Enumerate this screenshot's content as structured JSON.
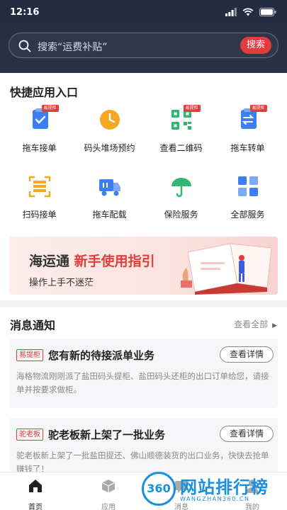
{
  "status_bar": {
    "time": "12:16"
  },
  "search": {
    "placeholder": "搜索“运费补贴”",
    "button": "搜索"
  },
  "quick_apps": {
    "title": "快捷应用入口",
    "items": [
      {
        "label": "拖车接单",
        "badge": "易提柜",
        "icon": "document-check-icon"
      },
      {
        "label": "码头堆场预约",
        "badge": "",
        "icon": "clock-icon"
      },
      {
        "label": "查看二维码",
        "badge": "易提柜",
        "icon": "qr-code-icon"
      },
      {
        "label": "拖车转单",
        "badge": "易提柜",
        "icon": "transfer-document-icon"
      },
      {
        "label": "扫码接单",
        "badge": "",
        "icon": "scan-icon"
      },
      {
        "label": "拖车配载",
        "badge": "",
        "icon": "truck-icon"
      },
      {
        "label": "保险服务",
        "badge": "",
        "icon": "umbrella-icon"
      },
      {
        "label": "全部服务",
        "badge": "",
        "icon": "grid-icon"
      }
    ]
  },
  "banner": {
    "brand": "海运通",
    "highlight": "新手使用指引",
    "subtitle": "操作上手不迷茫"
  },
  "messages": {
    "title": "消息通知",
    "view_all": "查看全部",
    "items": [
      {
        "tag": "易提柜",
        "title": "您有新的待接派单业务",
        "action": "查看详情",
        "body": "海格物流刚刚派了盐田码头提柜、盐田码头还柜的出口订单给您，请接单并按要求做柜。"
      },
      {
        "tag": "驼老板",
        "title": "驼老板新上架了一批业务",
        "action": "查看详情",
        "body": "驼老板新上架了一批盐田提还、佛山顺德装货的出口业务，快快去抢单赚钱了！"
      }
    ]
  },
  "tab_bar": {
    "items": [
      {
        "label": "首页"
      },
      {
        "label": "应用"
      },
      {
        "label": "消息"
      },
      {
        "label": "我的"
      }
    ]
  },
  "watermark": {
    "logo": "360",
    "title": "网站排行榜",
    "url": "WANGZHAN360.CN"
  },
  "colors": {
    "accent": "#e23d3d",
    "header_bg": "#262c40",
    "icon_blue": "#3d7ff0",
    "icon_orange": "#f5a623",
    "icon_green": "#2eb872"
  }
}
